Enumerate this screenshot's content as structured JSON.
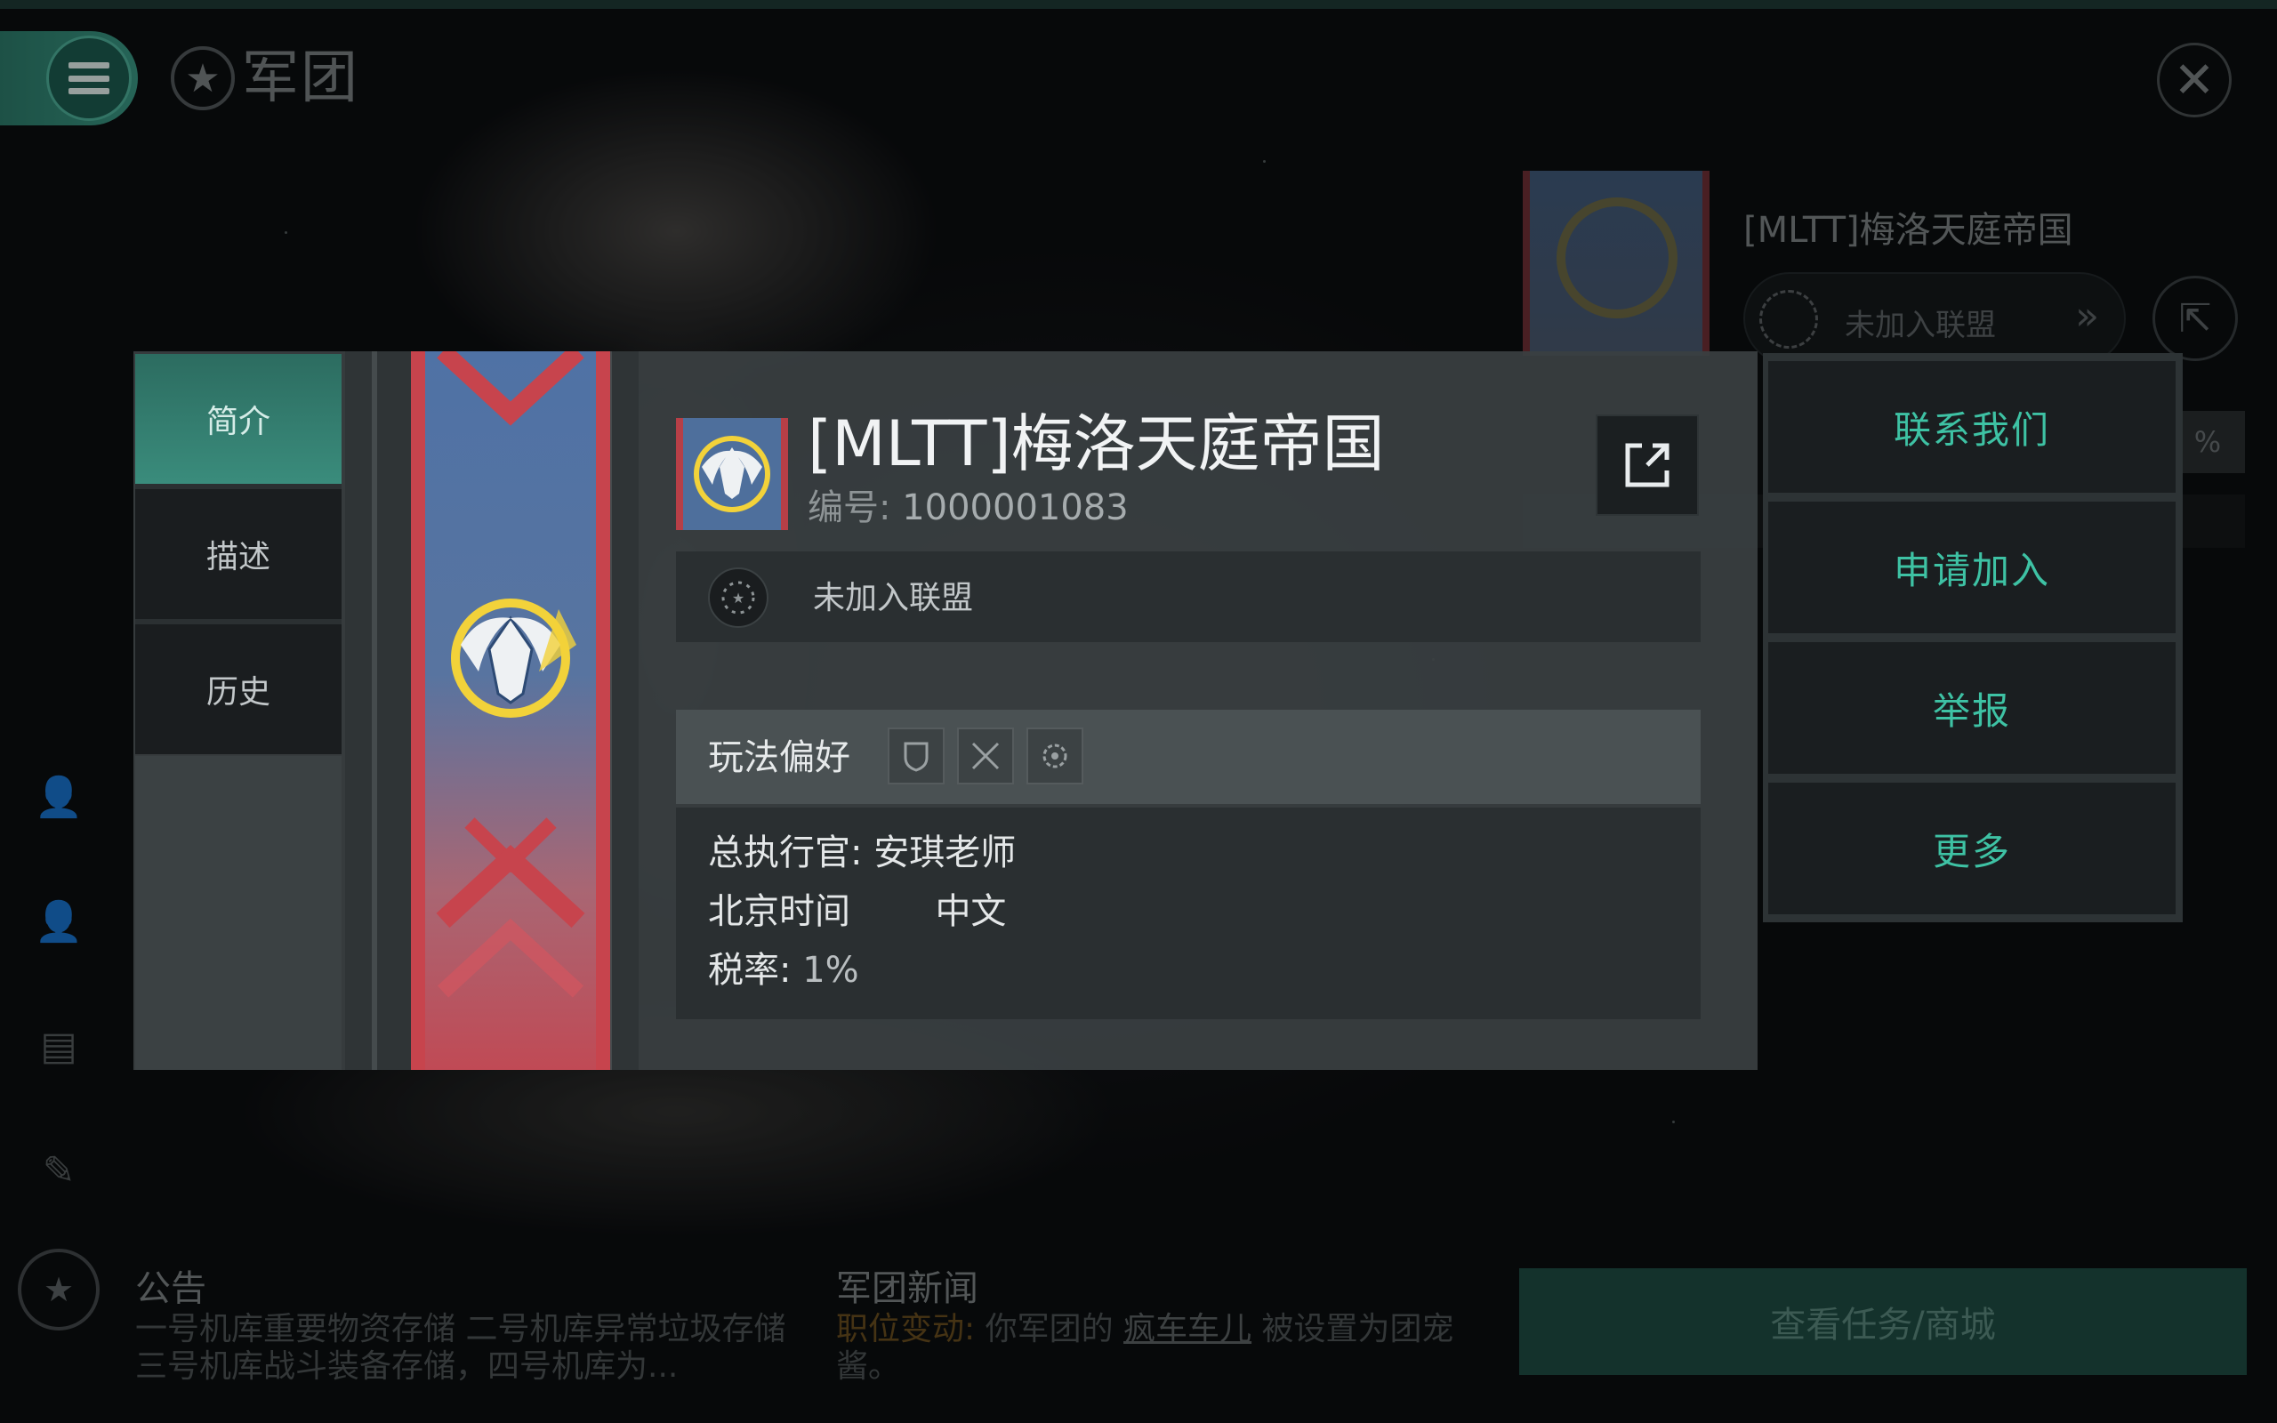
{
  "header": {
    "title": "军团"
  },
  "background": {
    "corp_name": "[MLTT]梅洛天庭帝国",
    "alliance_status": "未加入联盟",
    "percent_tail": "%",
    "announcement_title": "公告",
    "announcement_text": "一号机库重要物资存储 二号机库异常垃圾存储 三号机库战斗装备存储，四号机库为...",
    "news_title": "军团新闻",
    "news_tag": "职位变动:",
    "news_text_a": "你军团的",
    "news_user": "疯车车儿",
    "news_text_b": "被设置为团宠酱。",
    "mission_button": "查看任务/商城"
  },
  "tabs": [
    {
      "label": "简介",
      "active": true
    },
    {
      "label": "描述",
      "active": false
    },
    {
      "label": "历史",
      "active": false
    }
  ],
  "corp": {
    "name": "[MLTT]梅洛天庭帝国",
    "id_label": "编号:",
    "id_value": "1000001083",
    "alliance": "未加入联盟",
    "play_pref_label": "玩法偏好",
    "ceo_label": "总执行官:",
    "ceo_value": "安琪老师",
    "timezone": "北京时间",
    "language": "中文",
    "tax_label": "税率:",
    "tax_value": "1%"
  },
  "actions": [
    "联系我们",
    "申请加入",
    "举报",
    "更多"
  ],
  "colors": {
    "accent": "#3ec2a4",
    "menu_green": "#3b9a86",
    "banner_blue": "#4f72a5",
    "banner_red": "#c7444d"
  },
  "icons": {
    "menu": "hamburger-icon",
    "header": "star-emblem-icon",
    "close": "close-icon",
    "external": "external-link-icon",
    "alliance": "alliance-stars-icon",
    "prefs": [
      "shield-icon",
      "crossed-swords-icon",
      "gear-icon"
    ]
  }
}
